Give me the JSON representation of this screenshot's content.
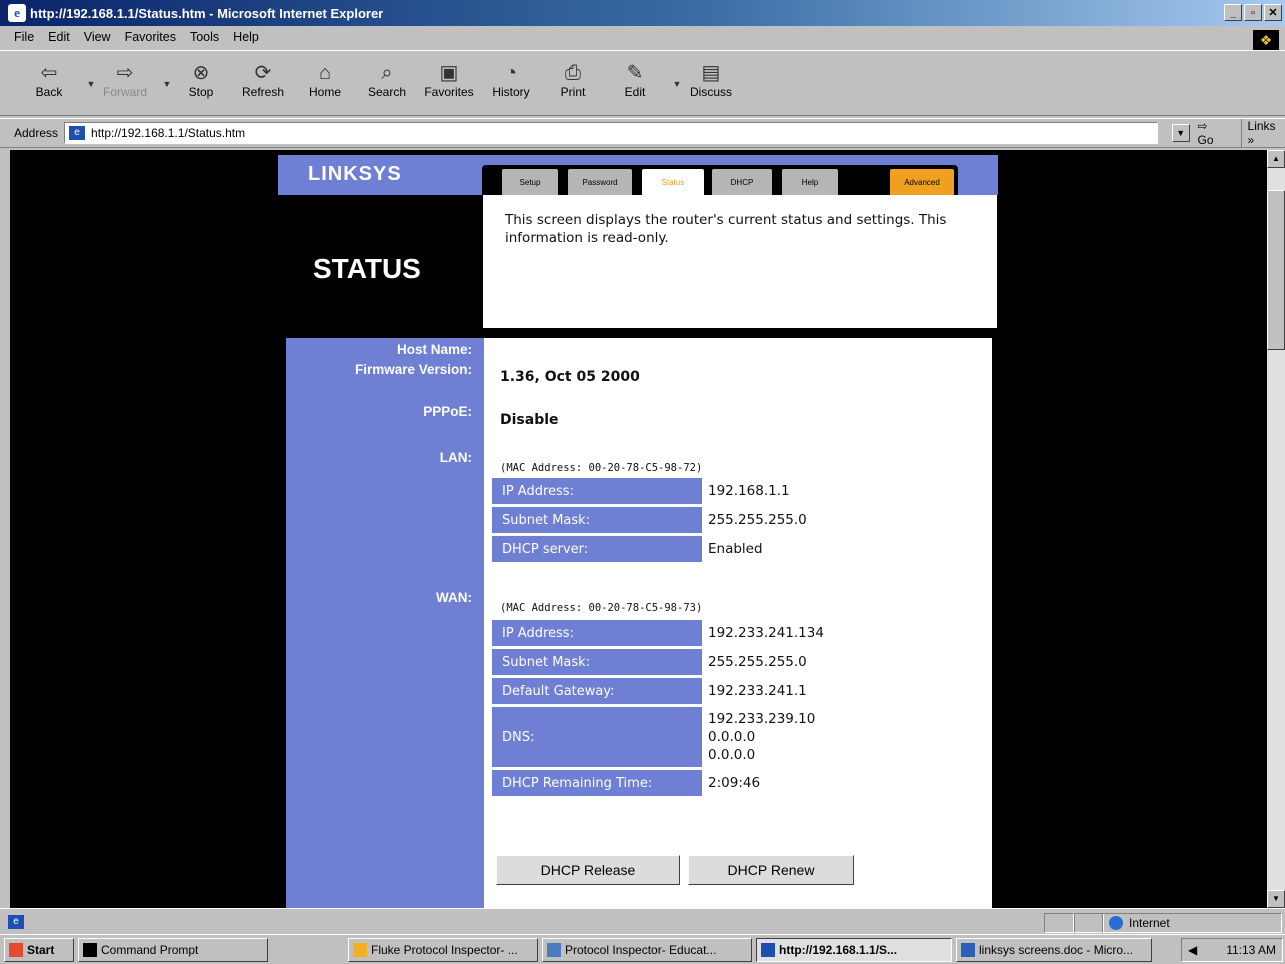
{
  "window": {
    "title": "http://192.168.1.1/Status.htm - Microsoft Internet Explorer"
  },
  "menu": [
    "File",
    "Edit",
    "View",
    "Favorites",
    "Tools",
    "Help"
  ],
  "toolbar": {
    "back": "Back",
    "forward": "Forward",
    "stop": "Stop",
    "refresh": "Refresh",
    "home": "Home",
    "search": "Search",
    "favorites": "Favorites",
    "history": "History",
    "print": "Print",
    "edit": "Edit",
    "discuss": "Discuss"
  },
  "address": {
    "label": "Address",
    "url": "http://192.168.1.1/Status.htm",
    "go": "Go",
    "links": "Links »"
  },
  "linksys": {
    "logo": "LINKSYS",
    "tabs": [
      "Setup",
      "Password",
      "Status",
      "DHCP",
      "Help",
      "Advanced"
    ],
    "active_tab": "Status",
    "page_title": "STATUS",
    "description": "This screen displays the router's current status and settings. This information is read-only."
  },
  "status": {
    "labels": {
      "host_name": "Host Name:",
      "firmware": "Firmware Version:",
      "pppoe": "PPPoE:",
      "lan": "LAN:",
      "wan": "WAN:"
    },
    "host_name": "",
    "firmware": "1.36, Oct 05 2000",
    "pppoe": "Disable",
    "lan": {
      "mac": "(MAC Address: 00-20-78-C5-98-72)",
      "ip_label": "IP Address:",
      "ip": "192.168.1.1",
      "mask_label": "Subnet Mask:",
      "mask": "255.255.255.0",
      "dhcp_label": "DHCP server:",
      "dhcp": "Enabled"
    },
    "wan": {
      "mac": "(MAC Address: 00-20-78-C5-98-73)",
      "ip_label": "IP Address:",
      "ip": "192.233.241.134",
      "mask_label": "Subnet Mask:",
      "mask": "255.255.255.0",
      "gateway_label": "Default Gateway:",
      "gateway": "192.233.241.1",
      "dns_label": "DNS:",
      "dns": [
        "192.233.239.10",
        "0.0.0.0",
        "0.0.0.0"
      ],
      "remaining_label": "DHCP Remaining Time:",
      "remaining": "2:09:46"
    },
    "buttons": {
      "release": "DHCP Release",
      "renew": "DHCP Renew"
    }
  },
  "statusbar": {
    "zone": "Internet"
  },
  "taskbar": {
    "start": "Start",
    "tasks": [
      "Command Prompt",
      "Fluke Protocol Inspector- ...",
      "Protocol Inspector- Educat...",
      "http://192.168.1.1/S...",
      "linksys screens.doc - Micro..."
    ],
    "clock": "11:13 AM"
  },
  "colors": {
    "linksys_purple": "#6f7fd3",
    "advanced_tab": "#f0a020",
    "title_bar": "#0a246a"
  }
}
